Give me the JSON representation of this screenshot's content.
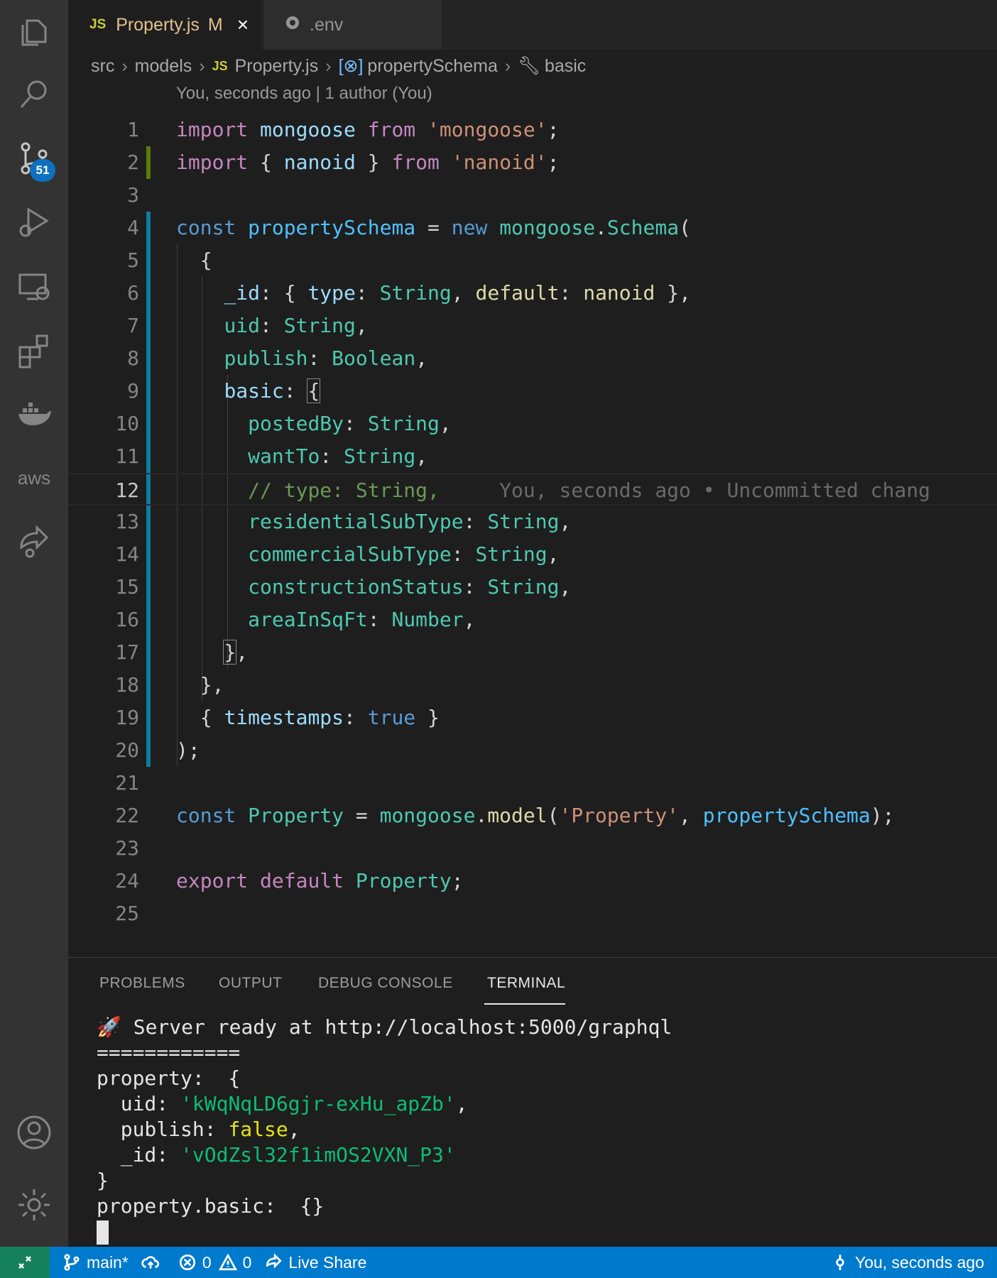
{
  "activity_bar": {
    "items": [
      "explorer-icon",
      "search-icon",
      "source-control-icon",
      "run-debug-icon",
      "remote-explorer-icon",
      "extensions-icon",
      "docker-icon",
      "aws-icon",
      "live-share-icon",
      "account-icon",
      "settings-gear-icon"
    ],
    "source_control_badge": "51",
    "aws_label": "aws"
  },
  "tabs": [
    {
      "icon": "JS",
      "label": "Property.js",
      "modified": "M",
      "close": "×"
    },
    {
      "icon": "gear-icon",
      "label": ".env"
    }
  ],
  "breadcrumb": [
    "src",
    "models",
    "Property.js",
    "propertySchema",
    "basic"
  ],
  "breadcrumb_js_icon": "JS",
  "codelens": "You, seconds ago | 1 author (You)",
  "editor": {
    "current_line": 12,
    "inline_blame": "You, seconds ago • Uncommitted chang",
    "line_numbers": [
      "1",
      "2",
      "3",
      "4",
      "5",
      "6",
      "7",
      "8",
      "9",
      "10",
      "11",
      "12",
      "13",
      "14",
      "15",
      "16",
      "17",
      "18",
      "19",
      "20",
      "21",
      "22",
      "23",
      "24",
      "25"
    ]
  },
  "panel": {
    "tabs": [
      "PROBLEMS",
      "OUTPUT",
      "DEBUG CONSOLE",
      "TERMINAL"
    ],
    "active_tab": "TERMINAL",
    "terminal": {
      "server_line": "🚀 Server ready at http://localhost:5000/graphql",
      "separator": "============",
      "property_open": "property:  {",
      "uid_key": "  uid: ",
      "uid_val": "'kWqNqLD6gjr-exHu_apZb'",
      "publish_key": "  publish: ",
      "publish_val": "false",
      "id_key": "  _id: ",
      "id_val": "'vOdZsl32f1imOS2VXN_P3'",
      "close": "}",
      "basic_line": "property.basic:  {}"
    }
  },
  "status_bar": {
    "branch": "main*",
    "errors": "0",
    "warnings": "0",
    "live_share": "Live Share",
    "blame": "You, seconds ago"
  }
}
